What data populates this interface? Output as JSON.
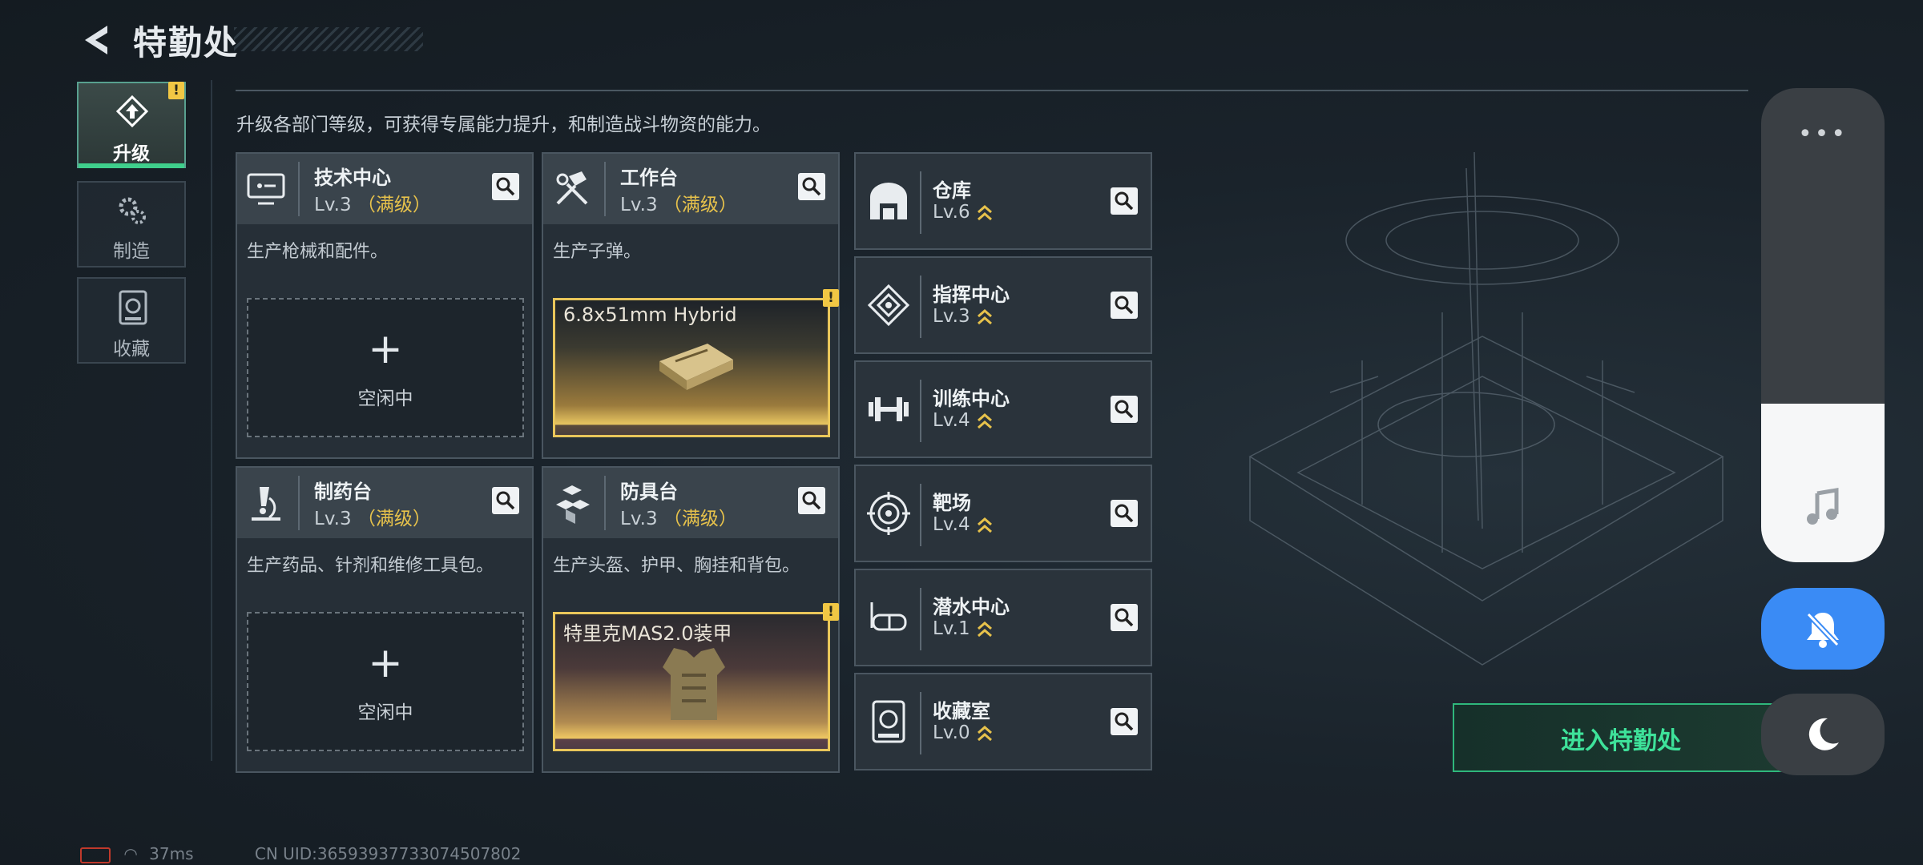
{
  "header": {
    "title": "特勤处"
  },
  "tabs": [
    {
      "label": "升级",
      "icon": "upgrade-icon",
      "active": true,
      "alert": "!"
    },
    {
      "label": "制造",
      "icon": "gears-icon",
      "active": false
    },
    {
      "label": "收藏",
      "icon": "vault-icon",
      "active": false
    }
  ],
  "intro": "升级各部门等级，可获得专属能力提升，和制造战斗物资的能力。",
  "facilities": [
    {
      "name": "技术中心",
      "level": "Lv.3",
      "max_label": "（满级）",
      "desc": "生产枪械和配件。",
      "slot_plus": "+",
      "slot_status": "空闲中",
      "icon": "monitor-icon"
    },
    {
      "name": "工作台",
      "level": "Lv.3",
      "max_label": "（满级）",
      "desc": "生产子弹。",
      "product": "6.8x51mm Hybrid",
      "alert": "!",
      "icon": "hammer-wrench-icon"
    },
    {
      "name": "制药台",
      "level": "Lv.3",
      "max_label": "（满级）",
      "desc": "生产药品、针剂和维修工具包。",
      "slot_plus": "+",
      "slot_status": "空闲中",
      "icon": "microscope-icon"
    },
    {
      "name": "防具台",
      "level": "Lv.3",
      "max_label": "（满级）",
      "desc": "生产头盔、护甲、胸挂和背包。",
      "product": "特里克MAS2.0装甲",
      "alert": "!",
      "icon": "armor-cubes-icon"
    }
  ],
  "departments": [
    {
      "name": "仓库",
      "level": "Lv.6",
      "icon": "warehouse-icon"
    },
    {
      "name": "指挥中心",
      "level": "Lv.3",
      "icon": "command-icon"
    },
    {
      "name": "训练中心",
      "level": "Lv.4",
      "icon": "dumbbell-icon"
    },
    {
      "name": "靶场",
      "level": "Lv.4",
      "icon": "target-icon"
    },
    {
      "name": "潜水中心",
      "level": "Lv.1",
      "icon": "goggles-icon"
    },
    {
      "name": "收藏室",
      "level": "Lv.0",
      "icon": "vault-icon"
    }
  ],
  "enter_button": "进入特勤处",
  "overlay": {
    "menu": "•••",
    "music_icon": "music-note-icon",
    "mute_icon": "bell-off-icon",
    "night_icon": "moon-icon"
  },
  "footer": {
    "ping": "37ms",
    "uid": "CN UID:36593937733074507802"
  },
  "colors": {
    "accent_green": "#3ee29a",
    "max_gold": "#e7c24b",
    "alert_yellow": "#f1c744",
    "blue": "#3a8bf5"
  }
}
